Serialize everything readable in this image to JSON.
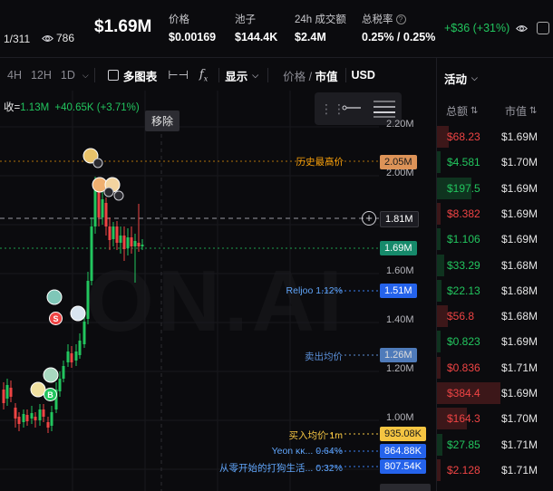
{
  "header": {
    "page_counter": "1/311",
    "views": "786",
    "price": "$1.69M",
    "stats": [
      {
        "label": "价格",
        "value": "$0.00169"
      },
      {
        "label": "池子",
        "value": "$144.4K"
      },
      {
        "label": "24h 成交额",
        "value": "$2.4M"
      },
      {
        "label": "总税率",
        "value": "0.25% / 0.25%"
      }
    ],
    "change": "+$36 (+31%)"
  },
  "toolbar": {
    "timeframes": [
      "4H",
      "12H",
      "1D"
    ],
    "multi_chart": "多图表",
    "display": "显示",
    "price_label": "价格",
    "mcap_label": "市值",
    "currency": "USD"
  },
  "chart": {
    "legend_prefix": "收=",
    "legend_close": "1.13M",
    "legend_change": "+40.65K (+3.71%)",
    "tooltip": "移除",
    "watermark": "ON.AI",
    "axis_labels": [
      "2.20M",
      "2.00M",
      "1.60M",
      "1.40M",
      "1.20M",
      "1.00M"
    ],
    "ath_label": "历史最高价",
    "ath_value": "2.05M",
    "crosshair_value": "1.81M",
    "current_value": "1.69M",
    "reljoo_label": "Reljoo 1.12%",
    "reljoo_value": "1.51M",
    "sell_avg_label": "卖出均价",
    "sell_avg_value": "1.26M",
    "buy_avg_label": "买入均价 1m",
    "buy_avg_value": "935.08K",
    "yeon_label": "Yeon ĸĸ... 0.64%",
    "yeon_value": "864.88K",
    "zero_label": "从零开始的打狗生活... 0.32%",
    "zero_value": "807.54K",
    "markers": [
      "S",
      "B"
    ]
  },
  "colors": {
    "up": "#22c55e",
    "down": "#ef4444",
    "ath": "#f59e0b",
    "blue": "#3b82f6"
  },
  "panel": {
    "tab": "活动",
    "col_amount": "总额",
    "col_mcap": "市值",
    "rows": [
      {
        "amount": "$68.23",
        "mcap": "$1.69M",
        "side": "sell",
        "fill": 0.1
      },
      {
        "amount": "$4.581",
        "mcap": "$1.70M",
        "side": "buy",
        "fill": 0.02
      },
      {
        "amount": "$197.5",
        "mcap": "$1.69M",
        "side": "buy",
        "fill": 0.3
      },
      {
        "amount": "$8.382",
        "mcap": "$1.69M",
        "side": "sell",
        "fill": 0.03
      },
      {
        "amount": "$1.106",
        "mcap": "$1.69M",
        "side": "buy",
        "fill": 0.01
      },
      {
        "amount": "$33.29",
        "mcap": "$1.68M",
        "side": "buy",
        "fill": 0.06
      },
      {
        "amount": "$22.13",
        "mcap": "$1.68M",
        "side": "buy",
        "fill": 0.04
      },
      {
        "amount": "$56.8",
        "mcap": "$1.68M",
        "side": "sell",
        "fill": 0.09
      },
      {
        "amount": "$0.823",
        "mcap": "$1.69M",
        "side": "buy",
        "fill": 0.01
      },
      {
        "amount": "$0.836",
        "mcap": "$1.71M",
        "side": "sell",
        "fill": 0.01
      },
      {
        "amount": "$384.4",
        "mcap": "$1.69M",
        "side": "sell",
        "fill": 0.55
      },
      {
        "amount": "$164.3",
        "mcap": "$1.70M",
        "side": "sell",
        "fill": 0.26
      },
      {
        "amount": "$27.85",
        "mcap": "$1.71M",
        "side": "buy",
        "fill": 0.05
      },
      {
        "amount": "$2.128",
        "mcap": "$1.71M",
        "side": "sell",
        "fill": 0.01
      }
    ]
  }
}
